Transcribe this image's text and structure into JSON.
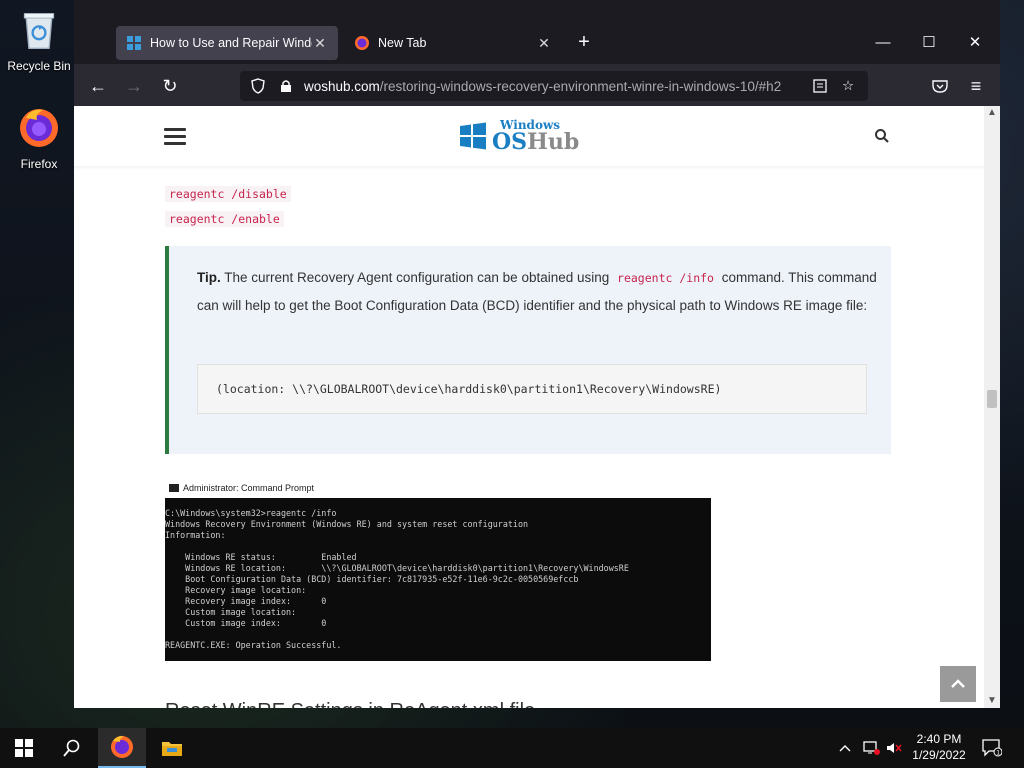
{
  "desktop": {
    "icons": [
      {
        "label": "Recycle Bin",
        "icon": "recycle-bin-icon"
      },
      {
        "label": "Firefox",
        "icon": "firefox-icon"
      }
    ]
  },
  "browser": {
    "tabs": [
      {
        "title": "How to Use and Repair Window",
        "active": true,
        "icon": "windows-logo-icon"
      },
      {
        "title": "New Tab",
        "active": false,
        "icon": "firefox-icon"
      }
    ],
    "new_tab_label": "+",
    "url": {
      "host": "woshub.com",
      "path": "/restoring-windows-recovery-environment-winre-in-windows-10/#h2"
    }
  },
  "page": {
    "logo": {
      "line1": "Windows",
      "line2_a": "OS",
      "line2_b": "Hub"
    },
    "commands": [
      "reagentc /disable",
      "reagentc /enable"
    ],
    "tip": {
      "label": "Tip.",
      "text_before": " The current Recovery Agent configuration can be obtained using ",
      "inline_code": "reagentc /info",
      "text_after": " command. This command can will help to get the Boot Configuration Data (BCD) identifier and the physical path to Windows RE image file:",
      "code_block": "(location: \\\\?\\GLOBALROOT\\device\\harddisk0\\partition1\\Recovery\\WindowsRE)"
    },
    "cmd_screenshot": {
      "title": "Administrator: Command Prompt",
      "lines": [
        "C:\\Windows\\system32>reagentc /info",
        "Windows Recovery Environment (Windows RE) and system reset configuration",
        "Information:",
        "",
        "    Windows RE status:         Enabled",
        "    Windows RE location:       \\\\?\\GLOBALROOT\\device\\harddisk0\\partition1\\Recovery\\WindowsRE",
        "    Boot Configuration Data (BCD) identifier: 7c817935-e52f-11e6-9c2c-0050569efccb",
        "    Recovery image location:",
        "    Recovery image index:      0",
        "    Custom image location:",
        "    Custom image index:        0",
        "",
        "REAGENTC.EXE: Operation Successful."
      ]
    },
    "next_heading": "Reset WinRE Settings in ReAgent.xml file"
  },
  "taskbar": {
    "clock_time": "2:40 PM",
    "clock_date": "1/29/2022",
    "notification_count": "1"
  },
  "colors": {
    "tab_active": "#42414d",
    "tip_border": "#2c7a3f",
    "code_pink": "#c7254e",
    "brand_blue": "#1a7ec3"
  }
}
